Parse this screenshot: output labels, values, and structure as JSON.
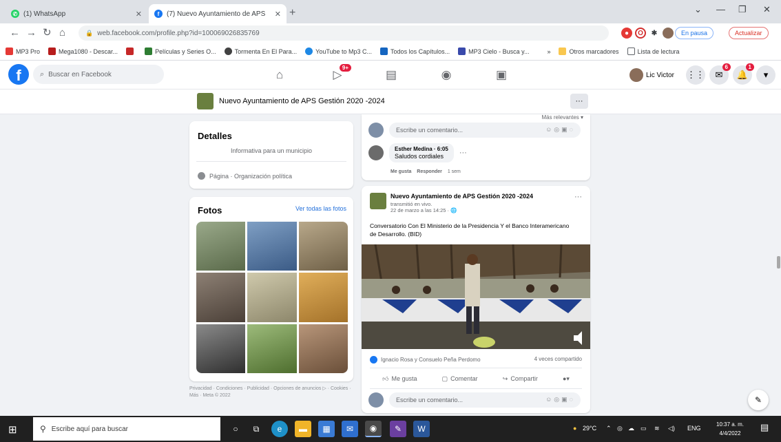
{
  "browser": {
    "tabs": [
      {
        "title": "(1) WhatsApp",
        "active": false
      },
      {
        "title": "(7) Nuevo Ayuntamiento de APS",
        "active": true
      }
    ],
    "address": "web.facebook.com/profile.php?id=100069026835769",
    "incognito_label": "En pausa",
    "update_label": "Actualizar",
    "bookmarks": [
      {
        "label": "MP3 Pro",
        "color": "#e53935"
      },
      {
        "label": "Mega1080 - Descar...",
        "color": "#b71c1c"
      },
      {
        "label": "",
        "color": "#c62828"
      },
      {
        "label": "Películas y Series O...",
        "color": "#2e7d32"
      },
      {
        "label": "Tormenta En El Para...",
        "color": "#424242"
      },
      {
        "label": "YouTube to Mp3 C...",
        "color": "#1e88e5"
      },
      {
        "label": "Todos los Capítulos...",
        "color": "#1565c0"
      },
      {
        "label": "MP3 Cielo - Busca y...",
        "color": "#3949ab"
      }
    ],
    "bookmarks_more": "»",
    "other_bookmarks": "Otros marcadores",
    "reading_list": "Lista de lectura"
  },
  "facebook": {
    "search_placeholder": "Buscar en Facebook",
    "watch_badge": "9+",
    "user_name": "Lic Victor",
    "messenger_badge": "6",
    "notifications_badge": "1"
  },
  "page": {
    "name": "Nuevo Ayuntamiento de APS Gestión 2020 -2024",
    "more_label": "···"
  },
  "details": {
    "title": "Detalles",
    "description": "Informativa para un municipio",
    "category": "Página · Organización política"
  },
  "photos": {
    "title": "Fotos",
    "see_all": "Ver todas las fotos",
    "tiles": [
      "#7a8a6a",
      "#4f6f9a",
      "#8c7d63",
      "#6b5e52",
      "#a9a48a",
      "#c28e3a",
      "#555555",
      "#6f8f4f",
      "#8d6f55"
    ]
  },
  "footer": "Privacidad · Condiciones · Publicidad · Opciones de anuncios ▷ · Cookies · Más · Meta © 2022",
  "comments": {
    "sort_label": "Más relevantes ▾",
    "write_placeholder": "Escribe un comentario...",
    "reply": {
      "author": "Esther Medina · 6:05",
      "text": "Saludos cordiales",
      "like": "Me gusta",
      "answer": "Responder",
      "time": "1 sem"
    }
  },
  "post": {
    "author": "Nuevo Ayuntamiento de APS Gestión 2020 -2024",
    "sub": "transmitió en vivo.",
    "date": "22 de marzo a las 14:25 · 🌐",
    "text": "Conversatorio Con  El Ministerio de la Presidencia Y el Banco Interamericano de Desarrollo.  (BID)",
    "reactions": "Ignacio Rosa y Consuelo Peña Perdomo",
    "shares": "4 veces compartido",
    "like_label": "Me gusta",
    "comment_label": "Comentar",
    "share_label": "Compartir",
    "write_placeholder": "Escribe un comentario..."
  },
  "taskbar": {
    "search_placeholder": "Escribe aquí para buscar",
    "weather": "29°C",
    "language": "ENG",
    "time": "10:37 a. m.",
    "date": "4/4/2022"
  }
}
